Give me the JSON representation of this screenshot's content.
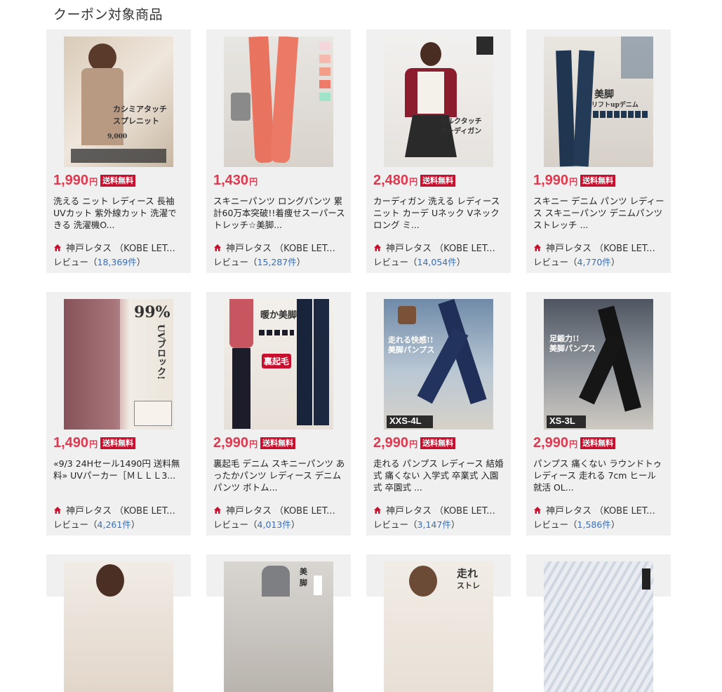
{
  "section_title": "クーポン対象商品",
  "colors": {
    "price": "#e0384f",
    "badge_bg": "#c8102e",
    "review_link": "#3a6fb0",
    "card_bg": "#f0f0f0"
  },
  "products": [
    {
      "price": "1,990",
      "yen": "円",
      "badge": "送料無料",
      "name": "洗える ニット レディース 長袖 UVカット 紫外線カット 洗濯できる 洗濯機O...",
      "shop": "神戸レタス （KOBE LET...",
      "review_label": "レビュー（",
      "review_count": "18,369件",
      "review_close": "）",
      "image_alt": "ニット 商品画像"
    },
    {
      "price": "1,430",
      "yen": "円",
      "badge": "",
      "name": "スキニーパンツ ロングパンツ 累計60万本突破!!着痩せスーパーストレッチ☆美脚...",
      "shop": "神戸レタス （KOBE LET...",
      "review_label": "レビュー（",
      "review_count": "15,287件",
      "review_close": "）",
      "image_alt": "スキニーパンツ 商品画像"
    },
    {
      "price": "2,480",
      "yen": "円",
      "badge": "送料無料",
      "name": "カーディガン 洗える レディース ニット カーデ Uネック Vネック ロング ミ...",
      "shop": "神戸レタス （KOBE LET...",
      "review_label": "レビュー（",
      "review_count": "14,054件",
      "review_close": "）",
      "image_alt": "カーディガン 商品画像"
    },
    {
      "price": "1,990",
      "yen": "円",
      "badge": "送料無料",
      "name": "スキニー デニム パンツ レディース スキニーパンツ デニムパンツ ストレッチ ...",
      "shop": "神戸レタス （KOBE LET...",
      "review_label": "レビュー（",
      "review_count": "4,770件",
      "review_close": "）",
      "image_alt": "デニム 商品画像"
    },
    {
      "price": "1,490",
      "yen": "円",
      "badge": "送料無料",
      "name": "«9/3 24Hセール1490円 送料無料» UVパーカー［ＭＬＬＬ3...",
      "shop": "神戸レタス （KOBE LET...",
      "review_label": "レビュー（",
      "review_count": "4,261件",
      "review_close": "）",
      "image_alt": "UVパーカー 商品画像"
    },
    {
      "price": "2,990",
      "yen": "円",
      "badge": "送料無料",
      "name": "裏起毛 デニム スキニーパンツ あったかパンツ レディース デニムパンツ ボトム...",
      "shop": "神戸レタス （KOBE LET...",
      "review_label": "レビュー（",
      "review_count": "4,013件",
      "review_close": "）",
      "image_alt": "裏起毛デニム 商品画像"
    },
    {
      "price": "2,990",
      "yen": "円",
      "badge": "送料無料",
      "name": "走れる パンプス レディース 結婚式 痛くない 入学式 卒業式 入園式 卒園式 ...",
      "shop": "神戸レタス （KOBE LET...",
      "review_label": "レビュー（",
      "review_count": "3,147件",
      "review_close": "）",
      "image_alt": "パンプス 商品画像"
    },
    {
      "price": "2,990",
      "yen": "円",
      "badge": "送料無料",
      "name": "パンプス 痛くない ラウンドトゥ レディース 走れる 7cm ヒール 就活 OL...",
      "shop": "神戸レタス （KOBE LET...",
      "review_label": "レビュー（",
      "review_count": "1,586件",
      "review_close": "）",
      "image_alt": "ラウンドトゥパンプス 商品画像"
    }
  ],
  "image_text": {
    "p1": [
      "カシミアタッチ",
      "スプレニット",
      "9,000"
    ],
    "p3": [
      "シルクタッチ",
      "カーディガン"
    ],
    "p4": [
      "美脚",
      "リフトupデニム"
    ],
    "p5": [
      "99%",
      "UVブロック!"
    ],
    "p6": [
      "暖か美脚",
      "裏起毛"
    ],
    "p7": [
      "走れる快感!!",
      "美脚パンプス",
      "XXS-4L"
    ],
    "p8": [
      "足鍛力!!",
      "美脚パンプス",
      "XS-3L"
    ],
    "p10": [
      "美",
      "脚"
    ],
    "p11": [
      "走れ",
      "ストレ"
    ]
  }
}
